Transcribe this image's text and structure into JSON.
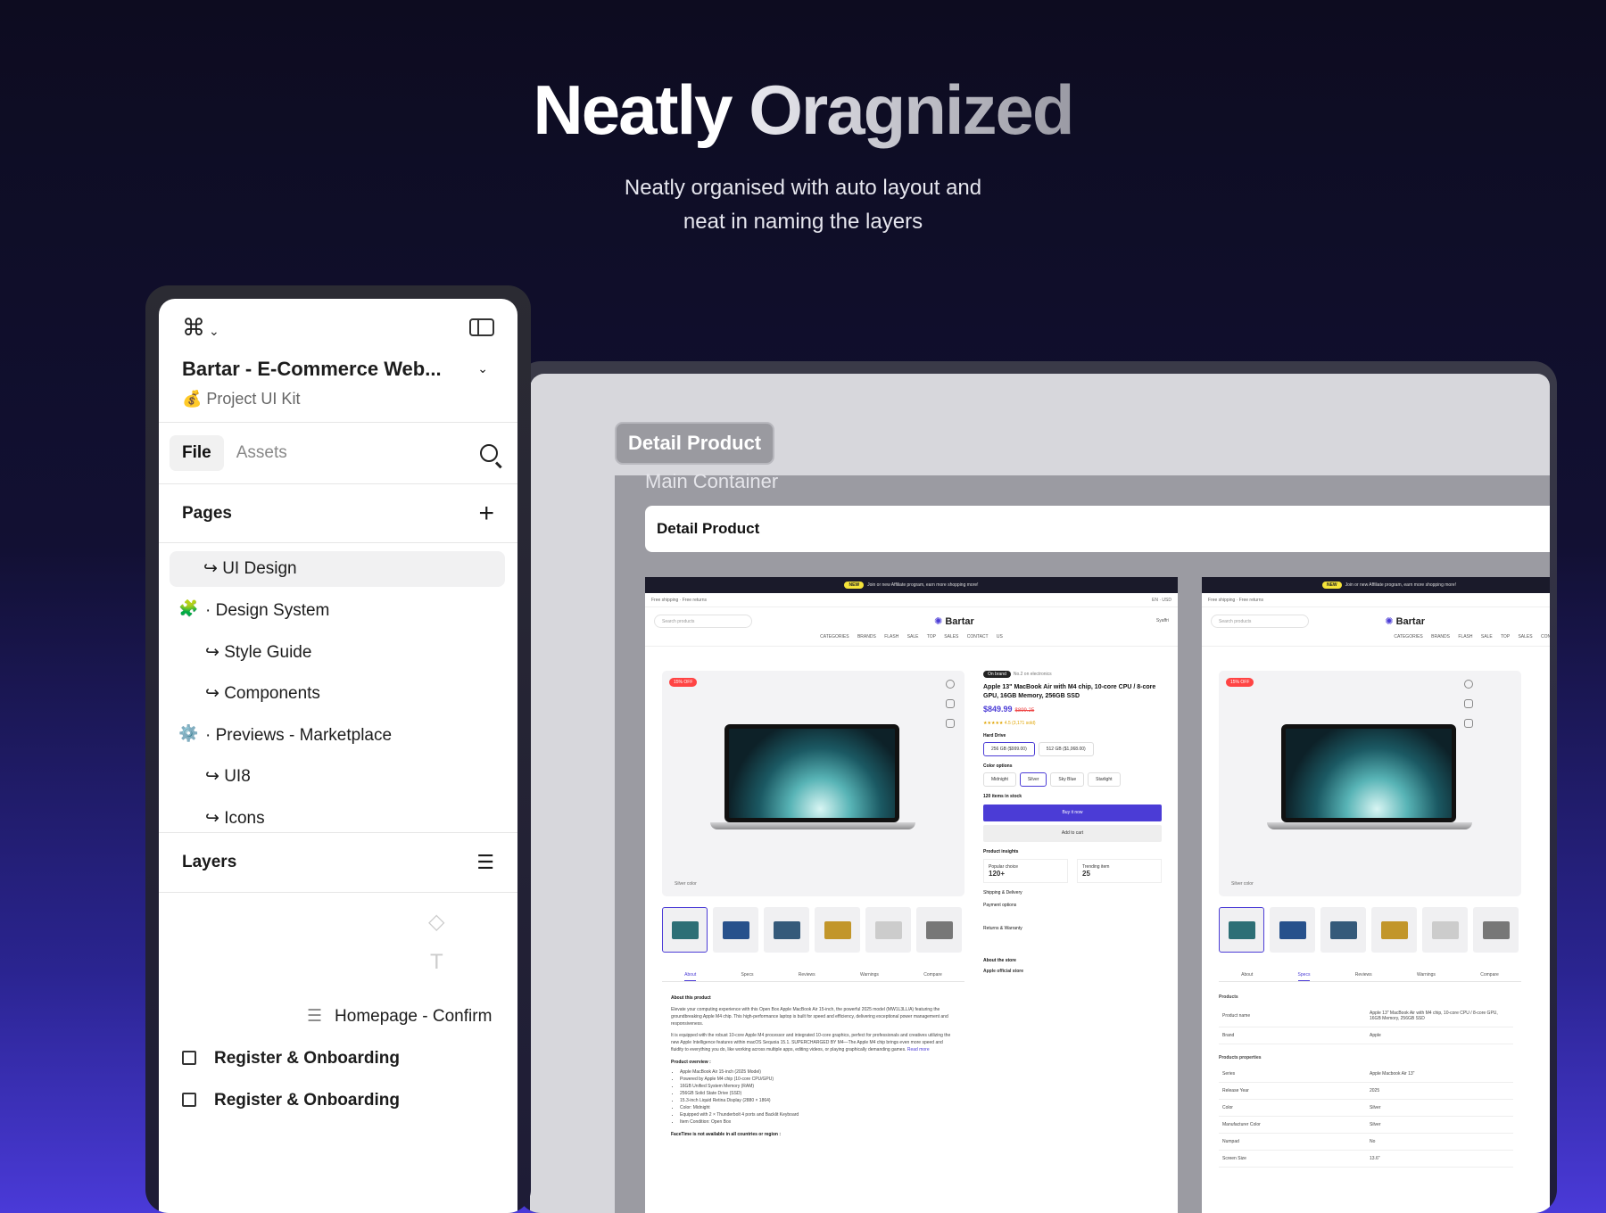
{
  "hero": {
    "title_part1": "Neatly",
    "title_part2": "Oragnized",
    "subtitle_line1": "Neatly organised with auto layout and",
    "subtitle_line2": "neat in naming the layers"
  },
  "sidebar": {
    "project_name": "Bartar - E-Commerce Web...",
    "project_sub": "💰 Project UI Kit",
    "tabs": [
      "File",
      "Assets"
    ],
    "pages_title": "Pages",
    "pages": [
      {
        "label": "↪ UI Design"
      },
      {
        "label": "· Design System",
        "emoji": "🧩"
      },
      {
        "label": "↪ Style Guide"
      },
      {
        "label": "↪ Components"
      },
      {
        "label": "· Previews - Marketplace",
        "emoji": "⚙️"
      },
      {
        "label": "↪ UI8"
      },
      {
        "label": "↪ Icons"
      }
    ],
    "layers_title": "Layers",
    "layers": [
      "Homepage - Confirm",
      "Register & Onboarding",
      "Register & Onboarding"
    ]
  },
  "canvas": {
    "frame_tag": "Detail Product",
    "main_container_label": "Main Container",
    "header_text": "Detail Product",
    "screen": {
      "promo_new": "NEW",
      "promo_text": "Join or new Affiliate program, earn more shopping more!",
      "util_left": "Free shipping · Free returns",
      "util_right": "EN · USD",
      "search_placeholder": "Search products",
      "brand": "Bartar",
      "user": "Syaffri",
      "categories": "CATEGORIES BRANDS FLASH SALE TOP SALES CONTACT US",
      "off_badge": "15% OFF",
      "color_label": "Silver color",
      "tabs": [
        "About",
        "Specs",
        "Reviews",
        "Warnings",
        "Compare"
      ],
      "chip1": "On brand",
      "chip2": "No.2 on electronics",
      "product_title": "Apple 13\" MacBook Air with M4 chip, 10-core CPU / 8-core GPU, 16GB Memory, 256GB SSD",
      "price": "$849.99",
      "old_price": "$899.25",
      "rating": "★★★★★ 4.5 (3,171 sold)",
      "hard_drive": "Hard Drive",
      "drive_options": [
        "256 GB ($999.00)",
        "512 GB ($1,068.00)"
      ],
      "color_options_label": "Color options",
      "color_options": [
        "Midnight",
        "Silver",
        "Sky Blue",
        "Starlight"
      ],
      "stock": "120 items in stock",
      "buy": "Buy it now",
      "cart": "Add to cart",
      "insights": "Product insights",
      "popular": "Popular choice",
      "popular_val": "120+",
      "trending": "Trending item",
      "trending_val": "25",
      "shipping": "Shipping & Delivery",
      "payment": "Payment options",
      "returns": "Returns & Warranty",
      "store_title": "About the store",
      "store_name": "Apple official store",
      "about_title": "About this product",
      "about_p1": "Elevate your computing experience with this Open Box Apple MacBook Air 15-inch, the powerful 2025 model (MW1L3LL/A) featuring the groundbreaking Apple M4 chip. This high-performance laptop is built for speed and efficiency, delivering exceptional power management and responsiveness.",
      "about_p2": "It is equipped with the robust 10-core Apple M4 processor and integrated 10-core graphics, perfect for professionals and creatives utilizing the new Apple Intelligence features within macOS Sequoia 15.1. SUPERCHARGED BY M4—The Apple M4 chip brings even more speed and fluidity to everything you do, like working across multiple apps, editing videos, or playing graphically demanding games.",
      "read_more": "Read more",
      "overview_title": "Product overview :",
      "overview": [
        "Apple MacBook Air 15-inch (2025 Model)",
        "Powered by Apple M4 chip (10-core CPU/GPU)",
        "16GB Unified System Memory (RAM)",
        "256GB Solid State Drive (SSD)",
        "15.3-inch Liquid Retina Display (2880 × 1864)",
        "Color: Midnight",
        "Equipped with 2 × Thunderbolt 4 ports and Backlit Keyboard",
        "Item Condition: Open Box"
      ],
      "facetime": "FaceTime is not available in all countries or region :",
      "products_label": "Products",
      "props_label": "Products properties",
      "spec_rows": [
        [
          "Product name",
          "Apple 13\" MacBook Air with M4 chip, 10-core CPU / 8-core GPU, 16GB Memory, 256GB SSD"
        ],
        [
          "Brand",
          "Apple"
        ]
      ],
      "prop_rows": [
        [
          "Series",
          "Apple Macbook Air 13\""
        ],
        [
          "Release Year",
          "2025"
        ],
        [
          "Color",
          "Silver"
        ],
        [
          "Manufacturer Color",
          "Silver"
        ],
        [
          "Numpad",
          "No"
        ],
        [
          "Screen Size",
          "13.6\""
        ]
      ]
    }
  }
}
